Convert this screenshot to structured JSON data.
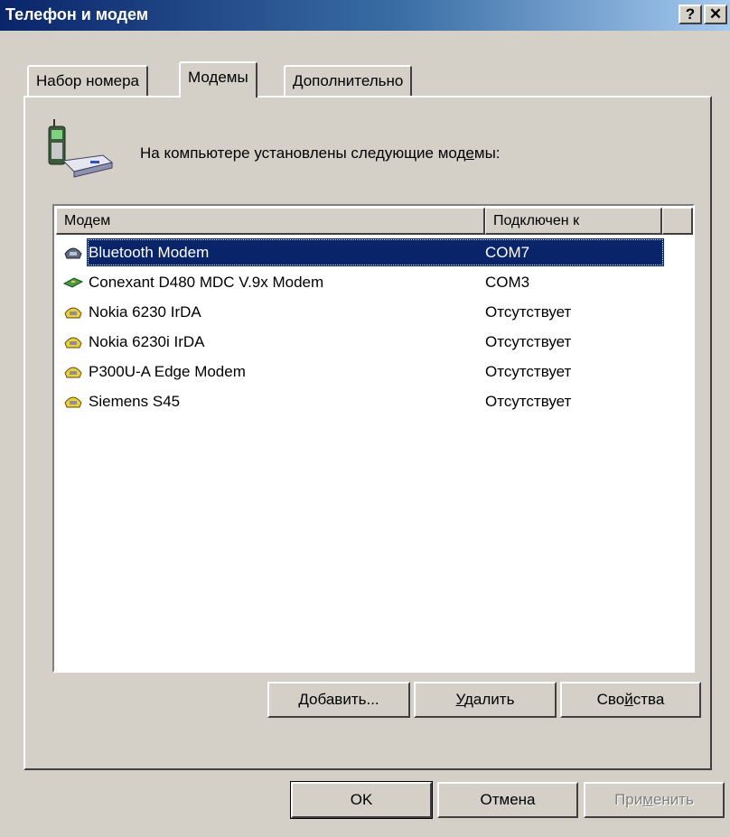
{
  "window": {
    "title": "Телефон и модем",
    "help_button": "?",
    "close_button": "✕"
  },
  "tabs": [
    {
      "label": "Набор номера",
      "active": false
    },
    {
      "label": "Модемы",
      "active": true
    },
    {
      "label": "Дополнительно",
      "active": false
    }
  ],
  "modems_page": {
    "heading_pre": "На компьютере установлены следующие мод",
    "heading_accel": "е",
    "heading_post": "мы:",
    "columns": [
      "Модем",
      "Подключен к"
    ],
    "rows": [
      {
        "name": "Bluetooth Modem",
        "port": "COM7",
        "selected": true,
        "icon": "modem-phone-icon"
      },
      {
        "name": "Conexant D480 MDC V.9x Modem",
        "port": "COM3",
        "selected": false,
        "icon": "modem-card-icon"
      },
      {
        "name": "Nokia 6230 IrDA",
        "port": "Отсутствует",
        "selected": false,
        "icon": "modem-phone-icon"
      },
      {
        "name": "Nokia 6230i IrDA",
        "port": "Отсутствует",
        "selected": false,
        "icon": "modem-phone-icon"
      },
      {
        "name": "P300U-A Edge Modem",
        "port": "Отсутствует",
        "selected": false,
        "icon": "modem-phone-icon"
      },
      {
        "name": "Siemens S45",
        "port": "Отсутствует",
        "selected": false,
        "icon": "modem-phone-icon"
      }
    ],
    "buttons": {
      "add_accel": "Д",
      "add_rest": "обавить...",
      "remove_accel": "У",
      "remove_rest": "далить",
      "props_pre": "Сво",
      "props_accel": "й",
      "props_post": "ства"
    }
  },
  "dialog_buttons": {
    "ok": "OK",
    "cancel": "Отмена",
    "apply_pre": "При",
    "apply_accel": "м",
    "apply_post": "енить",
    "apply_disabled": true
  },
  "colors": {
    "title_gradient_start": "#0a246a",
    "title_gradient_end": "#a6caf0",
    "selection": "#0a246a",
    "face": "#d4d0c8"
  }
}
